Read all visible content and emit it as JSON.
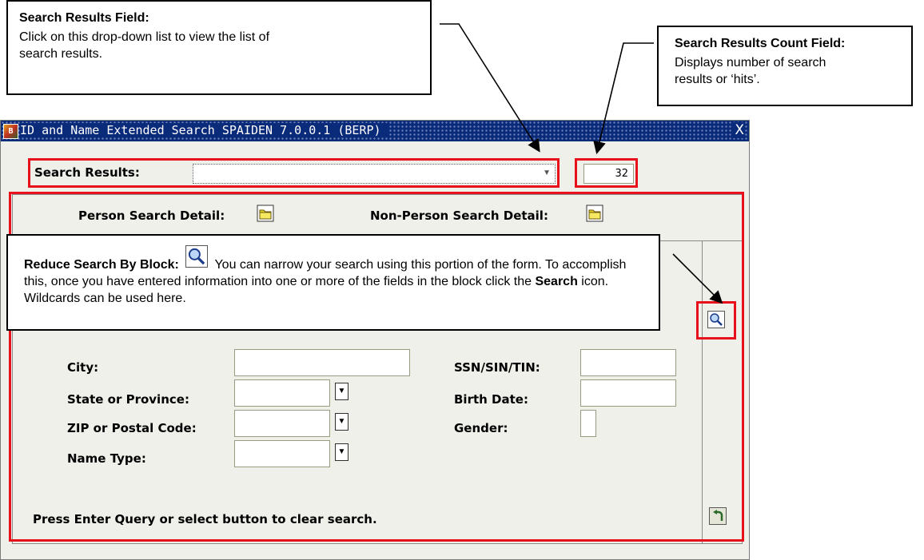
{
  "callouts": {
    "search_results": {
      "title": "Search Results Field:",
      "body": "Click on this drop-down list to view the list of search results."
    },
    "count": {
      "title": "Search Results Count Field:",
      "body": "Displays number of search results or ‘hits’."
    },
    "reduce": {
      "title": "Reduce Search By Block:",
      "body_pre": "You can narrow your search using this portion of the form. To accomplish this, once you have entered information into one or more of the fields in the block click the ",
      "body_bold": "Search",
      "body_post": " icon. Wildcards can be used here."
    }
  },
  "window": {
    "title": "ID and Name Extended Search  SPAIDEN  7.0.0.1  (BERP)",
    "close": "X"
  },
  "search": {
    "label": "Search Results:",
    "value": "",
    "count": "32"
  },
  "details": {
    "person_label": "Person Search Detail:",
    "nonperson_label": "Non-Person Search Detail:"
  },
  "form": {
    "city_label": "City:",
    "state_label": "State or Province:",
    "zip_label": "ZIP or Postal Code:",
    "nametype_label": "Name Type:",
    "ssn_label": "SSN/SIN/TIN:",
    "birth_label": "Birth Date:",
    "gender_label": "Gender:",
    "city": "",
    "state": "",
    "zip": "",
    "nametype": "",
    "ssn": "",
    "birth": "",
    "gender": ""
  },
  "status": {
    "message": "Press Enter Query or select button to clear search."
  },
  "colors": {
    "highlight": "#e8101a",
    "titlebar": "#0a2a7a",
    "form_bg": "#f0f0ea"
  }
}
